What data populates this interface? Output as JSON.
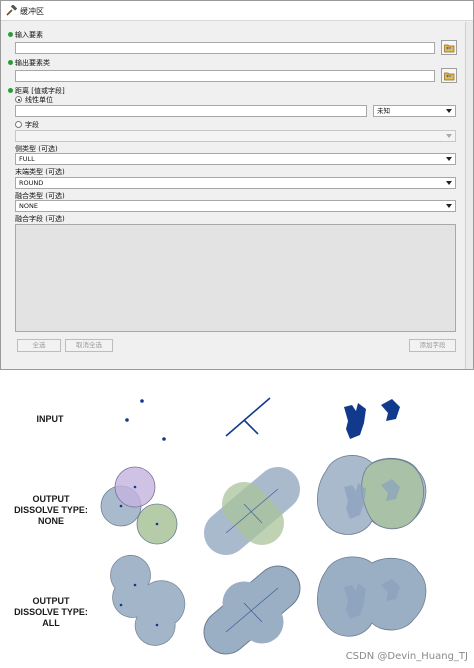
{
  "dialog": {
    "title": "缓冲区",
    "input_features_label": "输入要素",
    "output_features_label": "输出要素类",
    "distance_label": "距离 [值或字段]",
    "linear_unit_label": "线性单位",
    "unit_value": "未知",
    "field_label": "字段",
    "side_type_label": "侧类型 (可选)",
    "side_type_value": "FULL",
    "end_type_label": "末端类型 (可选)",
    "end_type_value": "ROUND",
    "dissolve_type_label": "融合类型 (可选)",
    "dissolve_type_value": "NONE",
    "dissolve_field_label": "融合字段 (可选)",
    "select_all": "全选",
    "unselect_all": "取消全选",
    "add_field": "添加字段"
  },
  "illustration": {
    "row_input": "INPUT",
    "row_none": [
      "OUTPUT",
      "DISSOLVE TYPE:",
      "NONE"
    ],
    "row_all": [
      "OUTPUT",
      "DISSOLVE TYPE:",
      "ALL"
    ],
    "colors": {
      "feature": "#123a8c",
      "buffer_blue": "#9aaec4",
      "buffer_purple": "#c4b3de",
      "buffer_green": "#a9c39a",
      "outline": "#6c7d92"
    }
  },
  "watermark": "CSDN @Devin_Huang_TJ"
}
